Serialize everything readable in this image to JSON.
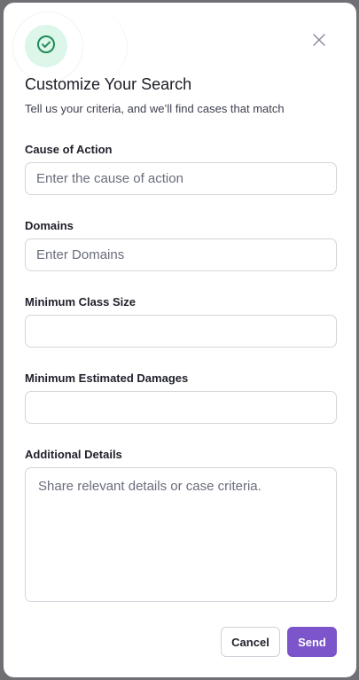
{
  "modal": {
    "title": "Customize Your Search",
    "subtitle": "Tell us your criteria, and we’ll find cases that match",
    "icon": "check-circle-icon",
    "close_icon": "close-icon"
  },
  "fields": {
    "cause_of_action": {
      "label": "Cause of Action",
      "placeholder": "Enter the cause of action",
      "value": ""
    },
    "domains": {
      "label": "Domains",
      "placeholder": "Enter Domains",
      "value": ""
    },
    "min_class_size": {
      "label": "Minimum Class Size",
      "placeholder": "",
      "value": ""
    },
    "min_estimated_damages": {
      "label": "Minimum Estimated Damages",
      "placeholder": "",
      "value": ""
    },
    "additional_details": {
      "label": "Additional Details",
      "placeholder": "Share relevant details or case criteria.",
      "value": ""
    }
  },
  "actions": {
    "cancel_label": "Cancel",
    "send_label": "Send"
  },
  "colors": {
    "accent": "#7b55c9",
    "success_bg": "#dcf6ea",
    "success_icon": "#1f8a55",
    "backdrop": "#6f6f74"
  }
}
